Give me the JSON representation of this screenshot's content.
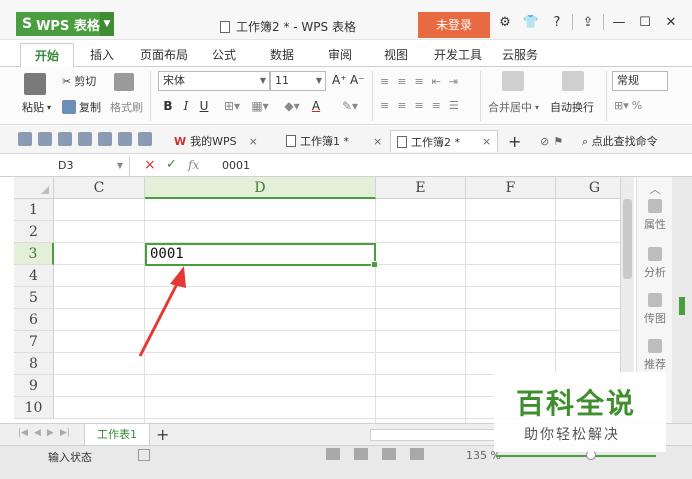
{
  "titlebar": {
    "app_name": "WPS 表格",
    "app_logo": "S",
    "document_title": "工作簿2 * - WPS 表格",
    "login_label": "未登录",
    "controls": {
      "help": "?"
    }
  },
  "tabs": [
    {
      "label": "开始",
      "active": true
    },
    {
      "label": "插入"
    },
    {
      "label": "页面布局"
    },
    {
      "label": "公式"
    },
    {
      "label": "数据"
    },
    {
      "label": "审阅"
    },
    {
      "label": "视图"
    },
    {
      "label": "开发工具"
    },
    {
      "label": "云服务"
    }
  ],
  "ribbon": {
    "paste": "粘贴",
    "cut": "剪切",
    "copy": "复制",
    "format_painter": "格式刷",
    "font_name": "宋体",
    "font_size": "11",
    "bold": "B",
    "italic": "I",
    "underline": "U",
    "font_color": "A",
    "grow_font": "A⁺",
    "shrink_font": "A⁻",
    "merge_center": "合并居中",
    "wrap_text": "自动换行",
    "number_format": "常规",
    "percent": "%"
  },
  "quickbar": {
    "doc_tabs": [
      {
        "label": "我的WPS",
        "close": "×"
      },
      {
        "label": "工作簿1 *",
        "close": "×"
      },
      {
        "label": "工作簿2 *",
        "close": "×",
        "active": true
      }
    ],
    "new_tab": "+",
    "search_command": "点此查找命令"
  },
  "formula_bar": {
    "cell_ref": "D3",
    "fx": "fx",
    "cancel": "×",
    "enter": "✓",
    "value": "0001"
  },
  "grid": {
    "columns": [
      "C",
      "D",
      "E",
      "F",
      "G"
    ],
    "selected_column": "D",
    "rows": [
      "1",
      "2",
      "3",
      "4",
      "5",
      "6",
      "7",
      "8",
      "9",
      "10"
    ],
    "selected_row": "3",
    "active_cell_value": "0001"
  },
  "side_pane": [
    {
      "label": "属性",
      "icon": "properties-icon"
    },
    {
      "label": "分析",
      "icon": "analysis-icon"
    },
    {
      "label": "传图",
      "icon": "upload-image-icon"
    },
    {
      "label": "推荐",
      "icon": "recommend-icon"
    }
  ],
  "sheetbar": {
    "sheet_name": "工作表1",
    "add_sheet": "+"
  },
  "status": {
    "text": "输入状态",
    "zoom": "135 %"
  },
  "watermark": {
    "title": "百科全说",
    "subtitle": "助你轻松解决"
  },
  "colors": {
    "accent": "#4a9e3f",
    "login": "#e86a40",
    "arrow": "#e53935"
  }
}
